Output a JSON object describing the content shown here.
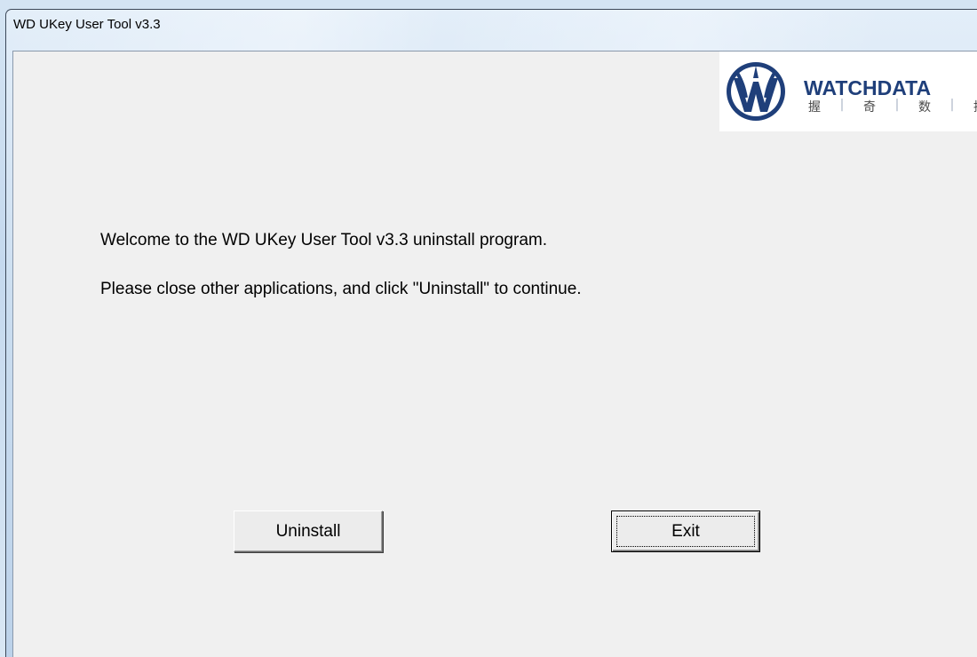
{
  "window": {
    "title": "WD UKey User Tool v3.3"
  },
  "logo": {
    "icon": "watchdata-logo-icon",
    "name": "WATCHDATA",
    "chinese": [
      "握",
      "奇",
      "数",
      "据"
    ]
  },
  "content": {
    "welcome": "Welcome to the WD UKey User Tool v3.3 uninstall program.",
    "instruction": "Please close other applications, and click \"Uninstall\" to continue."
  },
  "buttons": {
    "uninstall": "Uninstall",
    "exit": "Exit"
  },
  "colors": {
    "brand": "#1f3f7a",
    "client_bg": "#f0f0f0"
  }
}
